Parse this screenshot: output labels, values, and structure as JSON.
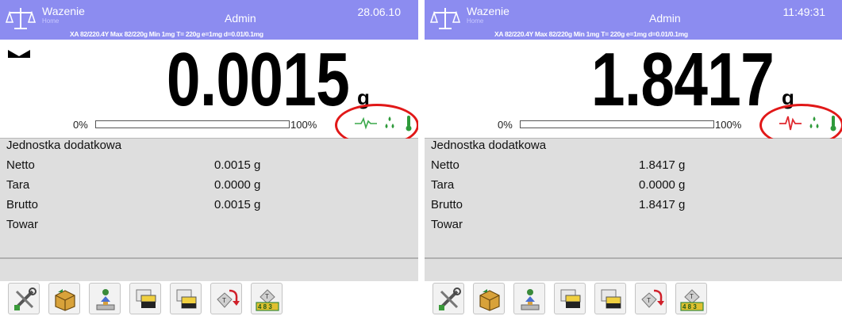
{
  "screens": [
    {
      "app_title": "Wazenie",
      "app_subtitle": "Home",
      "user": "Admin",
      "clock": "28.06.10",
      "spec_line": "XA 82/220.4Y  Max 82/220g  Min 1mg  T= 220g  e=1mg  d=0.01/0.1mg",
      "weight": "0.0015",
      "unit": "g",
      "bar_min": "0%",
      "bar_max": "100%",
      "bar_fill_fraction": 0.0,
      "info_title": "Jednostka dodatkowa",
      "rows": [
        {
          "label": "Netto",
          "value": "0.0015 g"
        },
        {
          "label": "Tara",
          "value": "0.0000 g"
        },
        {
          "label": "Brutto",
          "value": "0.0015 g"
        },
        {
          "label": "Towar",
          "value": ""
        }
      ],
      "status_icons": [
        "stability-wave-icon",
        "humidity-drops-icon",
        "thermometer-icon"
      ],
      "stability_color": "#3aa84a",
      "toolbar": [
        "settings-tools-icon",
        "product-box-icon",
        "weighing-operator-icon",
        "print-header-icon",
        "print-footer-icon",
        "tare-undo-icon",
        "tare-database-icon"
      ]
    },
    {
      "app_title": "Wazenie",
      "app_subtitle": "Home",
      "user": "Admin",
      "clock": "11:49:31",
      "spec_line": "XA 82/220.4Y  Max 82/220g  Min 1mg  T= 220g  e=1mg  d=0.01/0.1mg",
      "weight": "1.8417",
      "unit": "g",
      "bar_min": "0%",
      "bar_max": "100%",
      "bar_fill_fraction": 0.0,
      "info_title": "Jednostka dodatkowa",
      "rows": [
        {
          "label": "Netto",
          "value": "1.8417 g"
        },
        {
          "label": "Tara",
          "value": "0.0000 g"
        },
        {
          "label": "Brutto",
          "value": "1.8417 g"
        },
        {
          "label": "Towar",
          "value": ""
        }
      ],
      "status_icons": [
        "stability-wave-icon",
        "humidity-drops-icon",
        "thermometer-icon"
      ],
      "stability_color": "#e0282e",
      "toolbar": [
        "settings-tools-icon",
        "product-box-icon",
        "weighing-operator-icon",
        "print-header-icon",
        "print-footer-icon",
        "tare-undo-icon",
        "tare-database-icon"
      ]
    }
  ],
  "colors": {
    "header": "#8c8cf0",
    "panel": "#dedede",
    "highlight_ring": "#e11818"
  }
}
